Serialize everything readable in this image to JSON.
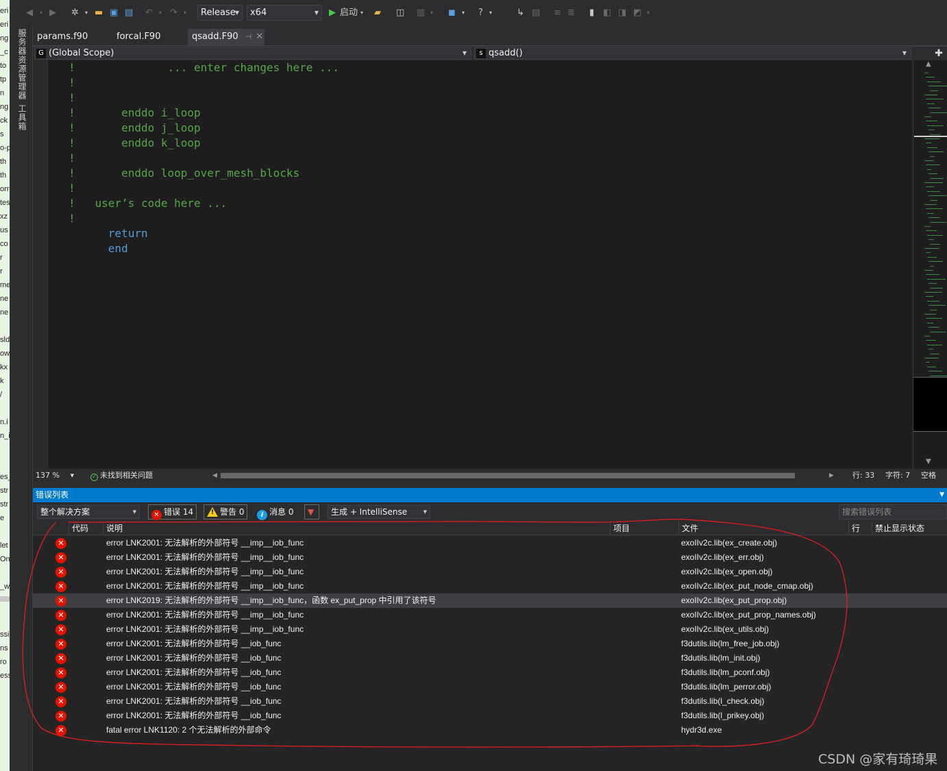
{
  "left_strip_fragments": [
    "eri",
    "eri",
    "ng",
    "_c",
    "to",
    "tp",
    "n",
    "ng",
    "ck",
    "s",
    "o-p",
    "th",
    "th",
    "orr",
    "tes",
    "xz",
    "us",
    "co",
    "r",
    "r",
    "me",
    "ne",
    "ne",
    "sld",
    "ow",
    "kx",
    "k",
    "/",
    "n.i",
    "n_i",
    "es_",
    "str",
    "str",
    "e",
    "let",
    "One",
    "_w",
    "ssi",
    "ns",
    "ro",
    "ess"
  ],
  "side_tabs": [
    "服务器资源管理器",
    "工具箱"
  ],
  "toolbar": {
    "configuration": "Release",
    "platform": "x64",
    "start_label": "启动"
  },
  "doc_tabs": [
    {
      "label": "params.f90",
      "active": false
    },
    {
      "label": "forcal.F90",
      "active": false
    },
    {
      "label": "qsadd.F90",
      "active": true
    }
  ],
  "scope": {
    "left_badge": "G",
    "left": "(Global Scope)",
    "right_badge": "s",
    "right": "qsadd()"
  },
  "code_lines": [
    {
      "text": "!              ... enter changes here ...",
      "kind": "comment"
    },
    {
      "text": "!",
      "kind": "comment"
    },
    {
      "text": "!",
      "kind": "comment"
    },
    {
      "text": "!       enddo i_loop",
      "kind": "comment"
    },
    {
      "text": "!       enddo j_loop",
      "kind": "comment"
    },
    {
      "text": "!       enddo k_loop",
      "kind": "comment"
    },
    {
      "text": "!",
      "kind": "comment"
    },
    {
      "text": "!       enddo loop_over_mesh_blocks",
      "kind": "comment"
    },
    {
      "text": "!",
      "kind": "comment"
    },
    {
      "text": "!   user’s code here ...",
      "kind": "comment"
    },
    {
      "text": "!",
      "kind": "comment"
    },
    {
      "text": "      return",
      "kind": "kw"
    },
    {
      "text": "      end",
      "kind": "kw"
    }
  ],
  "editor_status": {
    "zoom": "137 %",
    "issues": "未找到相关问题",
    "line": "行: 33",
    "char": "字符: 7",
    "mode": "空格"
  },
  "error_list": {
    "title": "错误列表",
    "scope_filter": "整个解决方案",
    "errors_label": "错误 14",
    "warnings_label": "警告 0",
    "messages_label": "消息 0",
    "build_filter": "生成 + IntelliSense",
    "search_placeholder": "搜索错误列表",
    "columns": [
      "代码",
      "说明",
      "项目",
      "文件",
      "行",
      "禁止显示状态"
    ],
    "rows": [
      {
        "desc": "error LNK2001: 无法解析的外部符号 __imp__iob_func",
        "file": "exoIIv2c.lib(ex_create.obj)"
      },
      {
        "desc": "error LNK2001: 无法解析的外部符号 __imp__iob_func",
        "file": "exoIIv2c.lib(ex_err.obj)"
      },
      {
        "desc": "error LNK2001: 无法解析的外部符号 __imp__iob_func",
        "file": "exoIIv2c.lib(ex_open.obj)"
      },
      {
        "desc": "error LNK2001: 无法解析的外部符号 __imp__iob_func",
        "file": "exoIIv2c.lib(ex_put_node_cmap.obj)"
      },
      {
        "desc": "error LNK2019: 无法解析的外部符号 __imp__iob_func，函数 ex_put_prop 中引用了该符号",
        "file": "exoIIv2c.lib(ex_put_prop.obj)"
      },
      {
        "desc": "error LNK2001: 无法解析的外部符号 __imp__iob_func",
        "file": "exoIIv2c.lib(ex_put_prop_names.obj)"
      },
      {
        "desc": "error LNK2001: 无法解析的外部符号 __imp__iob_func",
        "file": "exoIIv2c.lib(ex_utils.obj)"
      },
      {
        "desc": "error LNK2001: 无法解析的外部符号 __iob_func",
        "file": "f3dutils.lib(lm_free_job.obj)"
      },
      {
        "desc": "error LNK2001: 无法解析的外部符号 __iob_func",
        "file": "f3dutils.lib(lm_init.obj)"
      },
      {
        "desc": "error LNK2001: 无法解析的外部符号 __iob_func",
        "file": "f3dutils.lib(lm_pconf.obj)"
      },
      {
        "desc": "error LNK2001: 无法解析的外部符号 __iob_func",
        "file": "f3dutils.lib(lm_perror.obj)"
      },
      {
        "desc": "error LNK2001: 无法解析的外部符号 __iob_func",
        "file": "f3dutils.lib(l_check.obj)"
      },
      {
        "desc": "error LNK2001: 无法解析的外部符号 __iob_func",
        "file": "f3dutils.lib(l_prikey.obj)"
      },
      {
        "desc": "fatal error LNK1120: 2 个无法解析的外部命令",
        "file": "hydr3d.exe"
      }
    ],
    "selected_row": 4
  },
  "watermark": "CSDN @家有琦琦果",
  "colors": {
    "accent": "#007acc",
    "error": "#e51400",
    "comment": "#57a64a",
    "keyword": "#569cd6",
    "annotation": "#d42020"
  },
  "icons": [
    "back-arrow-icon",
    "forward-arrow-icon",
    "new-project-icon",
    "open-folder-icon",
    "save-icon",
    "save-all-icon",
    "undo-icon",
    "redo-icon",
    "play-icon",
    "find-in-files-icon",
    "bookmark-icon",
    "help-icon"
  ]
}
